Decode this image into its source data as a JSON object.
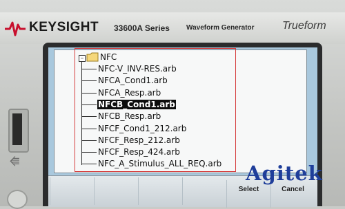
{
  "header": {
    "brand": "KEYSIGHT",
    "model": "33600A Series",
    "model_subtitle": "Waveform Generator",
    "product_line": "Trueform"
  },
  "file_browser": {
    "root": {
      "expander": "−",
      "label": "NFC"
    },
    "items": [
      {
        "label": "NFC-V_INV-RES.arb",
        "selected": false
      },
      {
        "label": "NFCA_Cond1.arb",
        "selected": false
      },
      {
        "label": "NFCA_Resp.arb",
        "selected": false
      },
      {
        "label": "NFCB_Cond1.arb",
        "selected": true
      },
      {
        "label": "NFCB_Resp.arb",
        "selected": false
      },
      {
        "label": "NFCF_Cond1_212.arb",
        "selected": false
      },
      {
        "label": "NFCF_Resp_212.arb",
        "selected": false
      },
      {
        "label": "NFCF_Resp_424.arb",
        "selected": false
      },
      {
        "label": "NFC_A_Stimulus_ALL_REQ.arb",
        "selected": false
      }
    ]
  },
  "softkeys": {
    "select": "Select",
    "cancel": "Cancel"
  },
  "watermark": "Agitek",
  "colors": {
    "screen_bg": "#a9c8dd",
    "selection_bg": "#0d0d0d",
    "highlight_box": "#d53b3b",
    "watermark": "#1f3e9a"
  },
  "icons": [
    "keysight-wave-icon",
    "folder-icon",
    "usb-icon",
    "power-icon"
  ]
}
